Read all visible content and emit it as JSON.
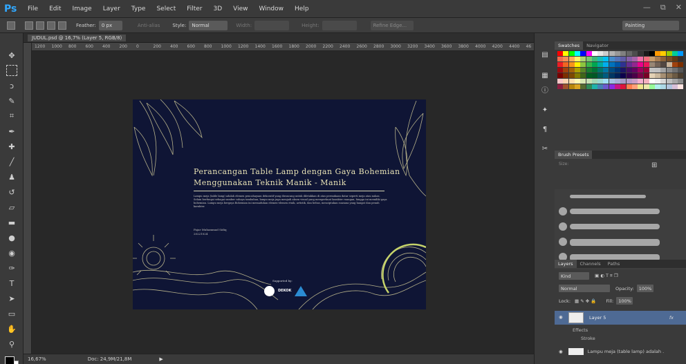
{
  "app": {
    "logo": "Ps",
    "menu": [
      "File",
      "Edit",
      "Image",
      "Layer",
      "Type",
      "Select",
      "Filter",
      "3D",
      "View",
      "Window",
      "Help"
    ],
    "window_controls": [
      "—",
      "⧉",
      "✕"
    ]
  },
  "options_bar": {
    "feather_label": "Feather:",
    "feather_value": "0 px",
    "antialias_label": "Anti-alias",
    "style_label": "Style:",
    "style_value": "Normal",
    "width_label": "Width:",
    "height_label": "Height:",
    "refine_edge_label": "Refine Edge...",
    "workspace": "Painting"
  },
  "document": {
    "tab_title": "JUDUL.psd @ 16,7% (Layer 5, RGB/8)",
    "ruler_ticks": [
      "1200",
      "1000",
      "800",
      "600",
      "400",
      "200",
      "0",
      "200",
      "400",
      "600",
      "800",
      "1000",
      "1200",
      "1400",
      "1600",
      "1800",
      "2000",
      "2200",
      "2400",
      "2600",
      "2800",
      "3000",
      "3200",
      "3400",
      "3600",
      "3800",
      "4000",
      "4200",
      "4400",
      "46"
    ],
    "title_line1": "Perancangan Table Lamp dengan Gaya Bohemian",
    "title_line2": "Menggunakan Teknik Manik - Manik",
    "body": "Lampu meja (table lamp) adalah elemen pencahayaan dekoratif yang dirancang untuk diletakkan di atas permukaan datar seperti meja atau nakas. Selain berfungsi sebagai sumber cahaya tambahan, lampu meja juga menjadi aksen visual yang memperkuat karakter ruangan, hingga ini memiliki gaya bohemian. Lampu meja bergaya Bohemian ini memadukan elemen-elemen etnik, artistik, dan bebas, menciptakan suasana yang hangat dan penuh karakter.",
    "author": "Fajar Muhammad Sidiq",
    "nim": "20221024",
    "supported_by": "Supported by:",
    "sponsor_text": "DEKOK"
  },
  "status_bar": {
    "zoom": "16,67%",
    "doc_size": "Doc: 24,9M/21,8M"
  },
  "panels": {
    "swatches_tabs": [
      "Swatches",
      "Navigator"
    ],
    "brush_tab": "Brush Presets",
    "brush_filter_label": "Size:",
    "layers_tabs": [
      "Layers",
      "Channels",
      "Paths"
    ],
    "kind_label": "Kind",
    "blend_mode": "Normal",
    "opacity_label": "Opacity:",
    "opacity_value": "100%",
    "lock_label": "Lock:",
    "fill_label": "Fill:",
    "fill_value": "100%",
    "layers": [
      {
        "name": "Layer 5",
        "fx": "fx"
      },
      {
        "name": "Effects"
      },
      {
        "name": "Stroke"
      },
      {
        "name": "Lampu meja (table lamp) adalah ..."
      }
    ]
  },
  "colors": {
    "doc_bg": "#0f1535",
    "title": "#e7e1b5",
    "selected_layer": "#4e6a94"
  }
}
